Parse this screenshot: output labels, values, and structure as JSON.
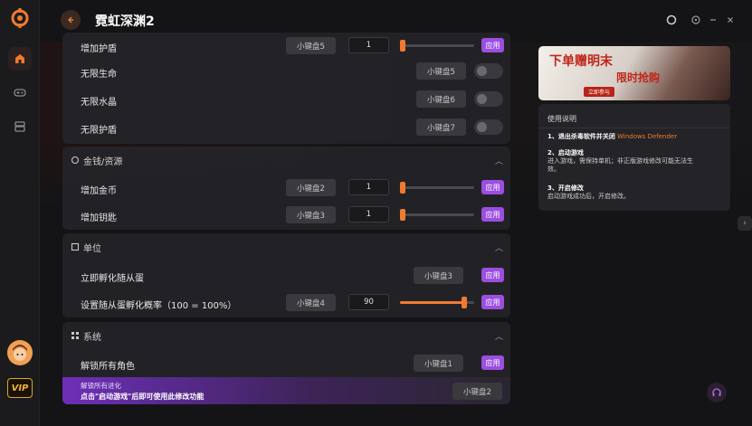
{
  "app": {
    "title": "霓虹深渊2",
    "vip_label": "VIP"
  },
  "sections": {
    "top_partial": {
      "rows": [
        {
          "label": "增加护盾",
          "key": "小键盘5",
          "value": "1",
          "apply": "应用"
        },
        {
          "label": "无限生命",
          "key": "小键盘5"
        },
        {
          "label": "无限水晶",
          "key": "小键盘6"
        },
        {
          "label": "无限护盾",
          "key": "小键盘7"
        }
      ]
    },
    "gold": {
      "title": "金钱/资源",
      "rows": [
        {
          "label": "增加金币",
          "key": "小键盘2",
          "value": "1",
          "apply": "应用"
        },
        {
          "label": "增加钥匙",
          "key": "小键盘3",
          "value": "1",
          "apply": "应用"
        }
      ]
    },
    "units": {
      "title": "单位",
      "rows": [
        {
          "label": "立即孵化随从蛋",
          "key": "小键盘3",
          "apply": "应用"
        },
        {
          "label": "设置随从蛋孵化概率（100 = 100%）",
          "key": "小键盘4",
          "value": "90",
          "apply": "应用"
        }
      ]
    },
    "system": {
      "title": "系统",
      "rows": [
        {
          "label": "解锁所有角色",
          "key": "小键盘1",
          "apply": "应用"
        }
      ],
      "locked": {
        "line1": "解锁所有进化",
        "line2": "点击\"启动游戏\"后即可使用此修改功能",
        "key": "小键盘2"
      }
    }
  },
  "sliders": {
    "gold_coin": 0.0,
    "gold_key": 0.0,
    "top_shield": 0.0,
    "hatch_rate": 0.9
  },
  "banner": {
    "text1": "下单赠明末",
    "text2": "限时抢购",
    "tag": "立即参与"
  },
  "guide": {
    "title": "使用说明",
    "step1_title": "1、退出杀毒软件并关闭",
    "step1_highlight": "Windows Defender",
    "step2_title": "2、启动游戏",
    "step2_body1": "进入游戏，需保持单机；非正版游戏修改可能无法生",
    "step2_body2": "效。",
    "step3_title": "3、开启修改",
    "step3_body": "启动游戏成功后，开启修改。"
  },
  "colors": {
    "accent": "#f07a30",
    "apply": "#9b4ee0",
    "vip": "#e0a42c"
  }
}
